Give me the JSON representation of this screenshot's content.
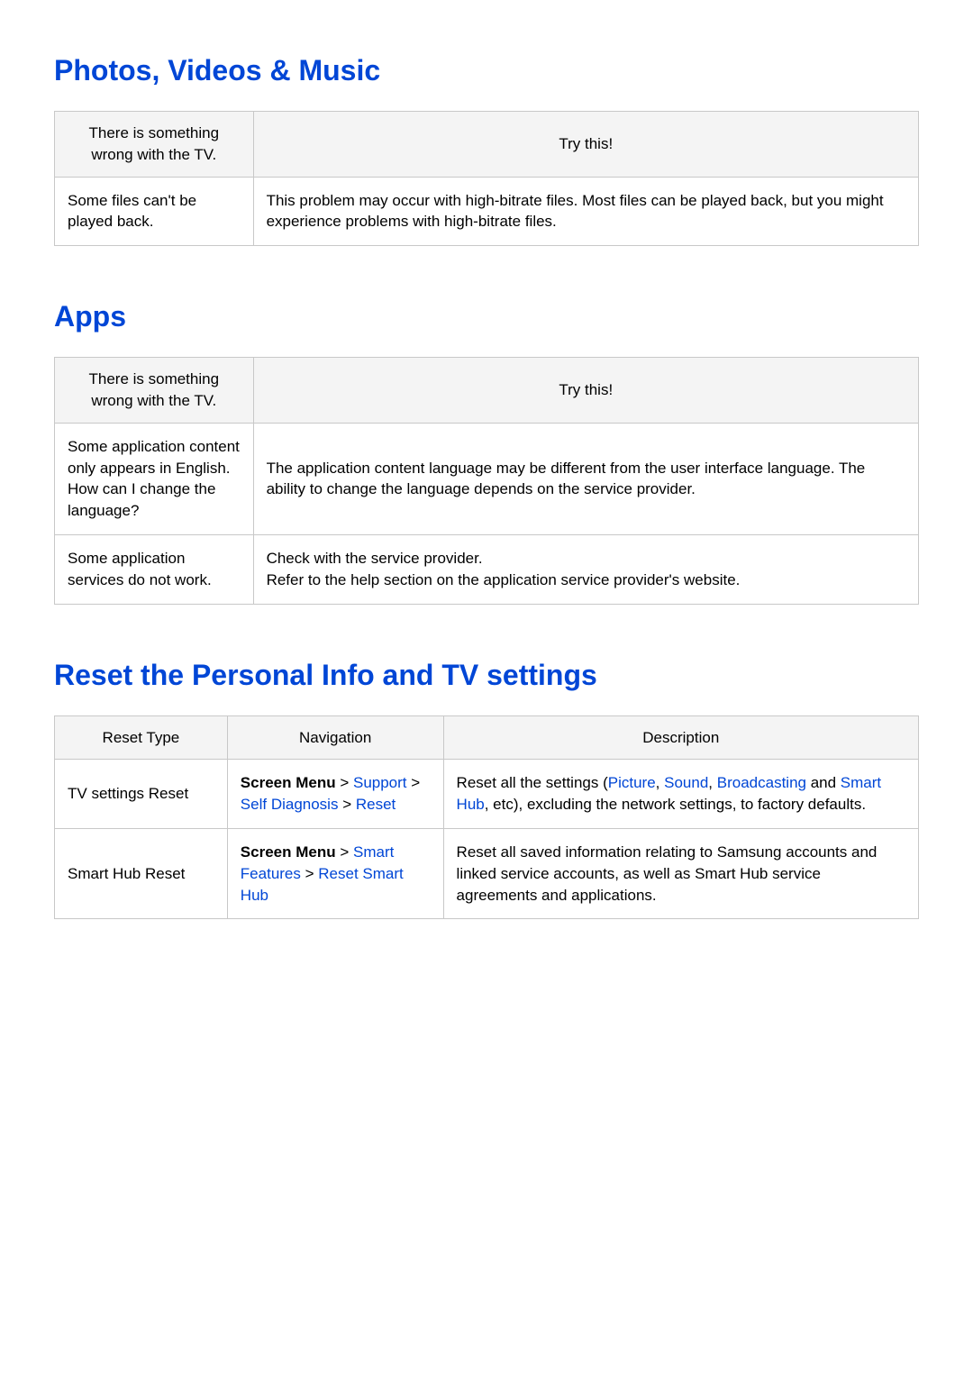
{
  "sections": {
    "photos": {
      "heading": "Photos, Videos & Music",
      "table": {
        "header_left": "There is something wrong with the TV.",
        "header_right": "Try this!",
        "rows": [
          {
            "issue": "Some files can't be played back.",
            "fix": "This problem may occur with high-bitrate files. Most files can be played back, but you might experience problems with high-bitrate files."
          }
        ]
      }
    },
    "apps": {
      "heading": "Apps",
      "table": {
        "header_left": "There is something wrong with the TV.",
        "header_right": "Try this!",
        "rows": [
          {
            "issue": "Some application content only appears in English. How can I change the language?",
            "fix": "The application content language may be different from the user interface language. The ability to change the language depends on the service provider."
          },
          {
            "issue": "Some application services do not work.",
            "fix_line1": "Check with the service provider.",
            "fix_line2": "Refer to the help section on the application service provider's website."
          }
        ]
      }
    },
    "reset": {
      "heading": "Reset the Personal Info and TV settings",
      "table": {
        "header_a": "Reset Type",
        "header_b": "Navigation",
        "header_c": "Description",
        "rows": [
          {
            "type": "TV settings Reset",
            "nav_prefix": "Screen Menu",
            "nav_sep": " > ",
            "nav_link1": "Support",
            "nav_link2": "Self Diagnosis",
            "nav_link3": "Reset",
            "desc_pre": "Reset all the settings (",
            "desc_link1": "Picture",
            "desc_c1": ", ",
            "desc_link2": "Sound",
            "desc_c2": ", ",
            "desc_link3": "Broadcasting",
            "desc_mid": " and ",
            "desc_link4": "Smart Hub",
            "desc_post": ", etc), excluding the network settings, to factory defaults."
          },
          {
            "type": "Smart Hub Reset",
            "nav_prefix": "Screen Menu",
            "nav_sep": " > ",
            "nav_link1": "Smart Features",
            "nav_link2": "Reset Smart Hub",
            "desc": "Reset all saved information relating to Samsung accounts and linked service accounts, as well as Smart Hub service agreements and applications."
          }
        ]
      }
    }
  }
}
